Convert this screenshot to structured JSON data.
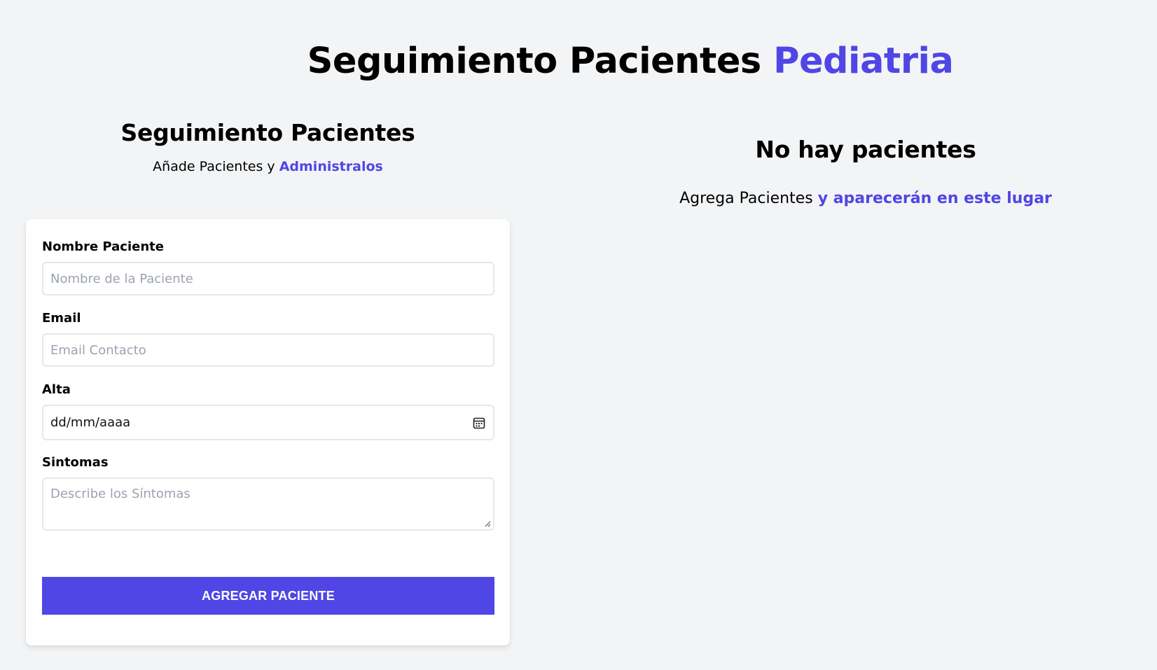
{
  "header": {
    "title_main": "Seguimiento Pacientes",
    "title_accent": "Pediatria"
  },
  "form_section": {
    "title": "Seguimiento Pacientes",
    "subtitle_main": "Añade Pacientes y",
    "subtitle_accent": "Administralos"
  },
  "form": {
    "name_label": "Nombre Paciente",
    "name_placeholder": "Nombre de la Paciente",
    "email_label": "Email",
    "email_placeholder": "Email Contacto",
    "date_label": "Alta",
    "date_value": "dd/mm/aaaa",
    "date_icon": "calendar-icon",
    "symptoms_label": "Sintomas",
    "symptoms_placeholder": "Describe los Síntomas",
    "submit_label": "AGREGAR PACIENTE"
  },
  "list_section": {
    "title": "No hay pacientes",
    "subtitle_main": "Agrega Pacientes",
    "subtitle_accent": "y aparecerán en este lugar"
  },
  "colors": {
    "accent": "#4f46e5",
    "background": "#f3f4f6",
    "card": "#ffffff"
  }
}
